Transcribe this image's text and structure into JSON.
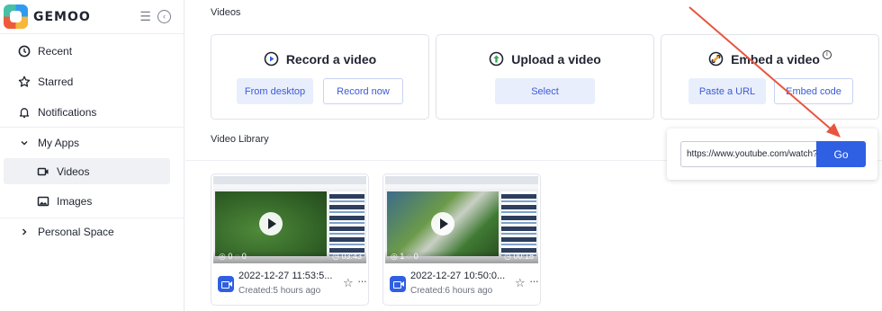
{
  "app": {
    "logo_text": "GEMOO"
  },
  "sidebar": {
    "items": [
      {
        "label": "Recent",
        "icon": "clock-icon"
      },
      {
        "label": "Starred",
        "icon": "star-icon"
      },
      {
        "label": "Notifications",
        "icon": "bell-icon"
      },
      {
        "label": "My Apps",
        "icon": "chevron-down-icon"
      },
      {
        "label": "Videos",
        "icon": "video-icon",
        "active": true
      },
      {
        "label": "Images",
        "icon": "image-icon"
      },
      {
        "label": "Personal Space",
        "icon": "chevron-right-icon"
      }
    ]
  },
  "main": {
    "section_title": "Videos",
    "cards": [
      {
        "title": "Record a video",
        "icon": "record-icon",
        "buttons": [
          "From desktop",
          "Record now"
        ]
      },
      {
        "title": "Upload a video",
        "icon": "upload-icon",
        "buttons": [
          "Select"
        ]
      },
      {
        "title": "Embed a video",
        "icon": "link-icon",
        "buttons": [
          "Paste a URL",
          "Embed code"
        ]
      }
    ],
    "library_title": "Video Library",
    "embed_popup": {
      "url_value": "https://www.youtube.com/watch?",
      "go_label": "Go"
    },
    "videos": [
      {
        "title": "2022-12-27 11:53:5...",
        "subtitle": "Created:5 hours ago",
        "views": "0",
        "comments": "0",
        "duration": "03:43"
      },
      {
        "title": "2022-12-27 10:50:0...",
        "subtitle": "Created:6 hours ago",
        "views": "1",
        "comments": "0",
        "duration": "00:18"
      }
    ]
  },
  "colors": {
    "accent": "#2f5fe2",
    "button_text": "#3b5bd6",
    "arrow": "#e8553f"
  }
}
